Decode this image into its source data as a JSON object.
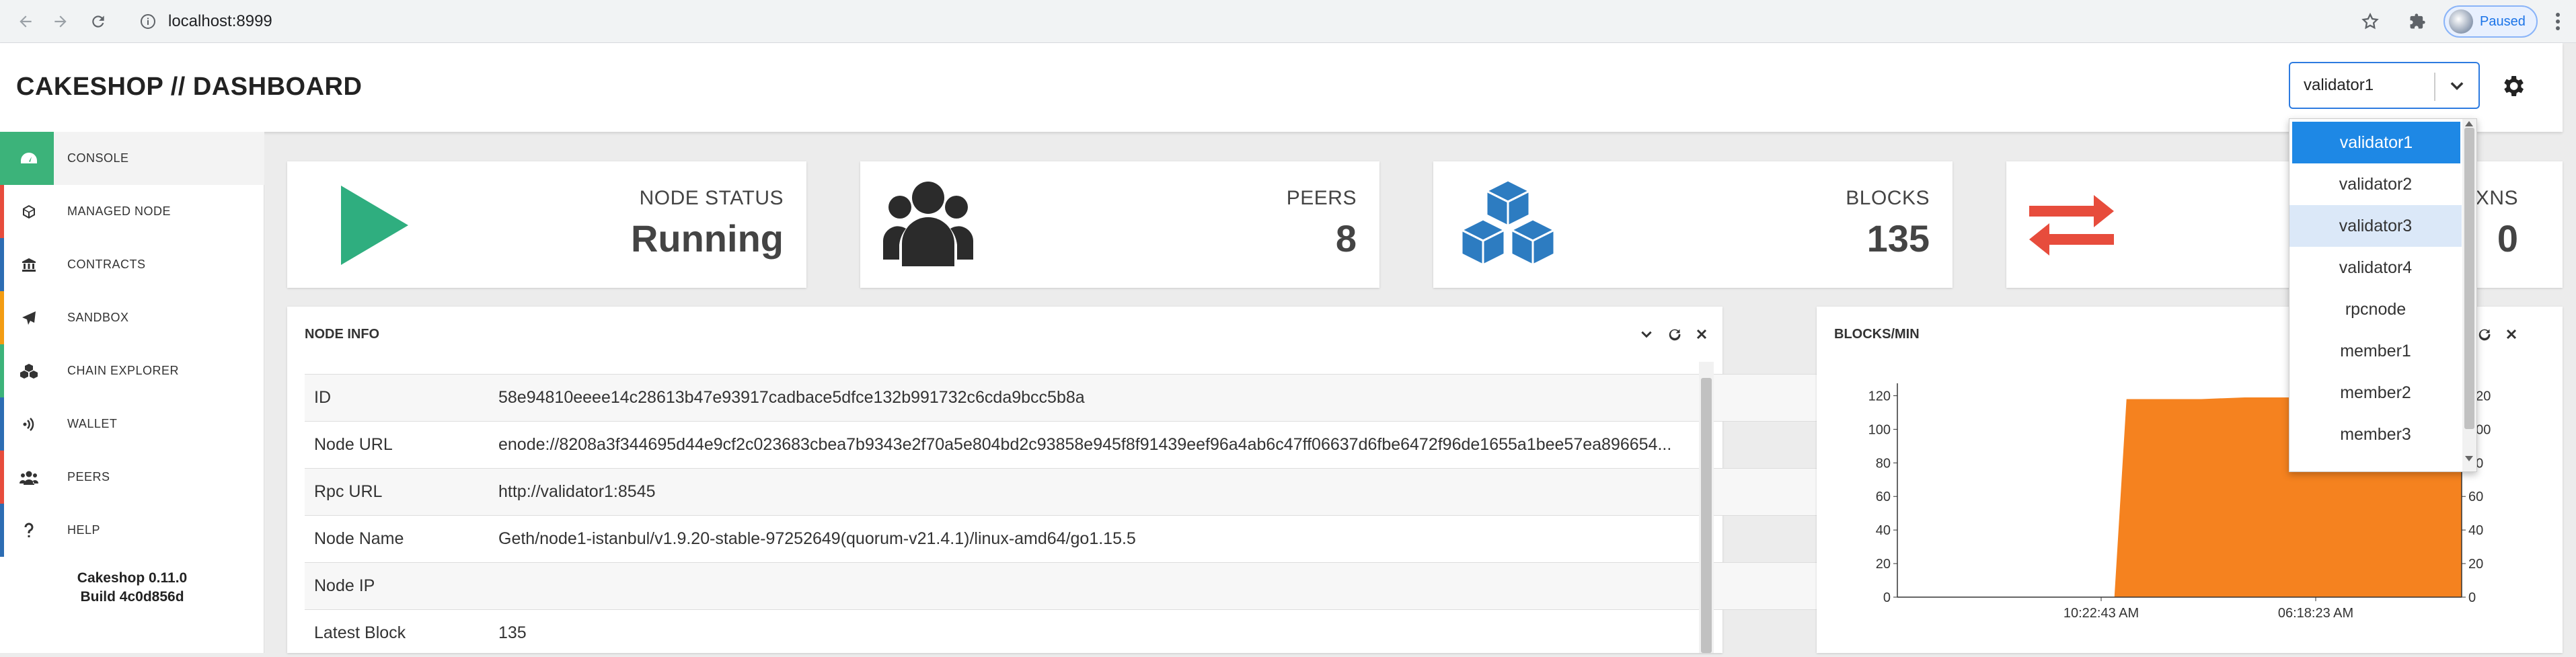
{
  "browser": {
    "url": "localhost:8999",
    "profile_status": "Paused"
  },
  "header": {
    "title": "CAKESHOP // DASHBOARD",
    "node_select_value": "validator1"
  },
  "sidebar": {
    "items": [
      {
        "label": "CONSOLE",
        "icon": "dashboard-icon",
        "active": true,
        "accent": "#3cb37a"
      },
      {
        "label": "MANAGED NODE",
        "icon": "cube-icon",
        "active": false,
        "accent": "#e74c3c"
      },
      {
        "label": "CONTRACTS",
        "icon": "bank-icon",
        "active": false,
        "accent": "#2d6db3"
      },
      {
        "label": "SANDBOX",
        "icon": "paper-plane-icon",
        "active": false,
        "accent": "#f39c12"
      },
      {
        "label": "CHAIN EXPLORER",
        "icon": "cubes-icon",
        "active": false,
        "accent": "#3cb37a"
      },
      {
        "label": "WALLET",
        "icon": "wifi-icon",
        "active": false,
        "accent": "#2d6db3"
      },
      {
        "label": "PEERS",
        "icon": "users-icon",
        "active": false,
        "accent": "#e74c3c"
      },
      {
        "label": "HELP",
        "icon": "question-icon",
        "active": false,
        "accent": "#2d6db3"
      }
    ],
    "version": "Cakeshop 0.11.0",
    "build": "Build 4c0d856d"
  },
  "cards": {
    "node_status": {
      "label": "NODE STATUS",
      "value": "Running",
      "icon": "play-icon",
      "color": "#2fae7f"
    },
    "peers": {
      "label": "PEERS",
      "value": "8",
      "icon": "users-icon",
      "color": "#2b2b2b"
    },
    "blocks": {
      "label": "BLOCKS",
      "value": "135",
      "icon": "cubes-icon",
      "color": "#2d7cc1"
    },
    "txns": {
      "label": "TXNS",
      "value": "0",
      "icon": "exchange-icon",
      "color": "#e74c3c"
    }
  },
  "node_info": {
    "title": "NODE INFO",
    "rows": [
      {
        "key": "ID",
        "value": "58e94810eeee14c28613b47e93917cadbace5dfce132b991732c6cda9bcc5b8a"
      },
      {
        "key": "Node URL",
        "value": "enode://8208a3f344695d44e9cf2c023683cbea7b9343e2f70a5e804bd2c93858e945f8f91439eef96a4ab6c47ff06637d6fbe6472f96de1655a1bee57ea896654..."
      },
      {
        "key": "Rpc URL",
        "value": "http://validator1:8545"
      },
      {
        "key": "Node Name",
        "value": "Geth/node1-istanbul/v1.9.20-stable-97252649(quorum-v21.4.1)/linux-amd64/go1.15.5"
      },
      {
        "key": "Node IP",
        "value": ""
      },
      {
        "key": "Latest Block",
        "value": "135"
      }
    ]
  },
  "blocks_panel": {
    "title": "BLOCKS/MIN"
  },
  "chart_data": {
    "type": "area",
    "title": "",
    "x_tick_labels": [
      "10:22:43 AM",
      "06:18:23 AM"
    ],
    "y_ticks_left": [
      0,
      20,
      40,
      60,
      80,
      100,
      120
    ],
    "y_ticks_right": [
      0,
      20,
      40,
      60,
      80,
      100,
      120
    ],
    "ylim": [
      0,
      125
    ],
    "color": "#f5821f",
    "series": [
      {
        "values": [
          0,
          0,
          0,
          0,
          0,
          0,
          118,
          118,
          119,
          119,
          119,
          119,
          119,
          119
        ]
      }
    ]
  },
  "dropdown": {
    "options": [
      "validator1",
      "validator2",
      "validator3",
      "validator4",
      "rpcnode",
      "member1",
      "member2",
      "member3"
    ],
    "selected": "validator1",
    "hovered": "validator3"
  }
}
